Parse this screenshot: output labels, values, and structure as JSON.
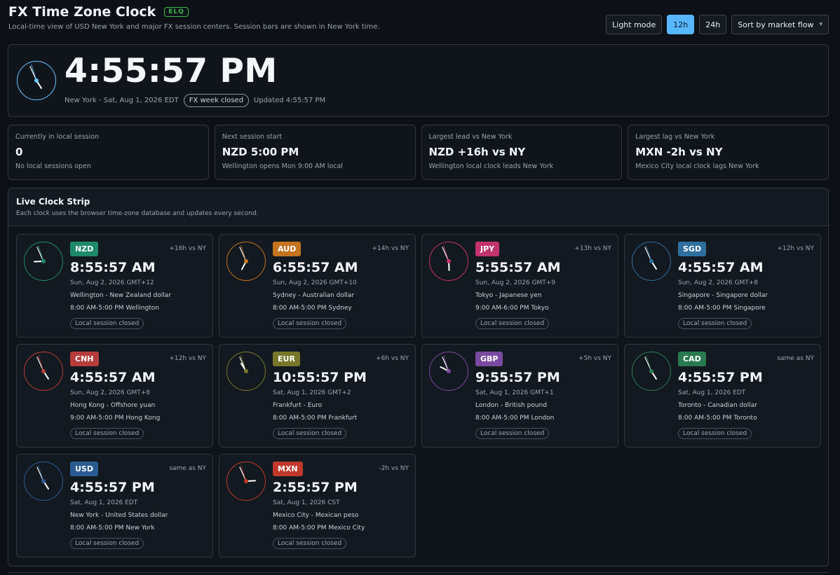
{
  "header": {
    "title": "FX Time Zone Clock",
    "badge": "ELQ",
    "subtitle": "Local-time view of USD New York and major FX session centers. Session bars are shown in New York time."
  },
  "controls": {
    "light_mode": "Light mode",
    "h12": "12h",
    "h24": "24h",
    "sort": "Sort by market flow",
    "active_format": "12h"
  },
  "hero": {
    "time": "4:55:57 PM",
    "location_date": "New York - Sat, Aug 1, 2026 EDT",
    "week_status": "FX week closed",
    "updated": "Updated 4:55:57 PM",
    "accent": "#6cc4ff"
  },
  "stats": [
    {
      "label": "Currently in local session",
      "value": "0",
      "note": "No local sessions open"
    },
    {
      "label": "Next session start",
      "value": "NZD 5:00 PM",
      "note": "Wellington opens Mon 9:00 AM local"
    },
    {
      "label": "Largest lead vs New York",
      "value": "NZD +16h vs NY",
      "note": "Wellington local clock leads New York"
    },
    {
      "label": "Largest lag vs New York",
      "value": "MXN -2h vs NY",
      "note": "Mexico City local clock lags New York"
    }
  ],
  "strip": {
    "title": "Live Clock Strip",
    "subtitle": "Each clock uses the browser time-zone database and updates every second."
  },
  "cards": [
    {
      "ccy": "NZD",
      "color": "#1f8a6b",
      "offset": "+16h vs NY",
      "time": "8:55:57 AM",
      "date": "Sun, Aug 2, 2026 GMT+12",
      "place": "Wellington - New Zealand dollar",
      "hours": "8:00 AM-5:00 PM Wellington",
      "status": "Local session closed",
      "h": 8,
      "m": 55,
      "s": 57
    },
    {
      "ccy": "AUD",
      "color": "#c4731f",
      "offset": "+14h vs NY",
      "time": "6:55:57 AM",
      "date": "Sun, Aug 2, 2026 GMT+10",
      "place": "Sydney - Australian dollar",
      "hours": "8:00 AM-5:00 PM Sydney",
      "status": "Local session closed",
      "h": 6,
      "m": 55,
      "s": 57
    },
    {
      "ccy": "JPY",
      "color": "#c2336e",
      "offset": "+13h vs NY",
      "time": "5:55:57 AM",
      "date": "Sun, Aug 2, 2026 GMT+9",
      "place": "Tokyo - Japanese yen",
      "hours": "9:00 AM-6:00 PM Tokyo",
      "status": "Local session closed",
      "h": 5,
      "m": 55,
      "s": 57
    },
    {
      "ccy": "SGD",
      "color": "#2f6f9f",
      "offset": "+12h vs NY",
      "time": "4:55:57 AM",
      "date": "Sun, Aug 2, 2026 GMT+8",
      "place": "Singapore - Singapore dollar",
      "hours": "8:00 AM-5:00 PM Singapore",
      "status": "Local session closed",
      "h": 4,
      "m": 55,
      "s": 57
    },
    {
      "ccy": "CNH",
      "color": "#b63c3c",
      "offset": "+12h vs NY",
      "time": "4:55:57 AM",
      "date": "Sun, Aug 2, 2026 GMT+8",
      "place": "Hong Kong - Offshore yuan",
      "hours": "9:00 AM-5:00 PM Hong Kong",
      "status": "Local session closed",
      "h": 4,
      "m": 55,
      "s": 57
    },
    {
      "ccy": "EUR",
      "color": "#77772a",
      "offset": "+6h vs NY",
      "time": "10:55:57 PM",
      "date": "Sat, Aug 1, 2026 GMT+2",
      "place": "Frankfurt - Euro",
      "hours": "8:00 AM-5:00 PM Frankfurt",
      "status": "Local session closed",
      "h": 10,
      "m": 55,
      "s": 57
    },
    {
      "ccy": "GBP",
      "color": "#7a4aa0",
      "offset": "+5h vs NY",
      "time": "9:55:57 PM",
      "date": "Sat, Aug 1, 2026 GMT+1",
      "place": "London - British pound",
      "hours": "8:00 AM-5:00 PM London",
      "status": "Local session closed",
      "h": 9,
      "m": 55,
      "s": 57
    },
    {
      "ccy": "CAD",
      "color": "#2a7a4f",
      "offset": "same as NY",
      "time": "4:55:57 PM",
      "date": "Sat, Aug 1, 2026 EDT",
      "place": "Toronto - Canadian dollar",
      "hours": "8:00 AM-5:00 PM Toronto",
      "status": "Local session closed",
      "h": 4,
      "m": 55,
      "s": 57
    },
    {
      "ccy": "USD",
      "color": "#2a5a92",
      "offset": "same as NY",
      "time": "4:55:57 PM",
      "date": "Sat, Aug 1, 2026 EDT",
      "place": "New York - United States dollar",
      "hours": "8:00 AM-5:00 PM New York",
      "status": "Local session closed",
      "h": 4,
      "m": 55,
      "s": 57
    },
    {
      "ccy": "MXN",
      "color": "#c0392b",
      "offset": "-2h vs NY",
      "time": "2:55:57 PM",
      "date": "Sat, Aug 1, 2026 CST",
      "place": "Mexico City - Mexican peso",
      "hours": "8:00 AM-5:00 PM Mexico City",
      "status": "Local session closed",
      "h": 2,
      "m": 55,
      "s": 57
    }
  ]
}
